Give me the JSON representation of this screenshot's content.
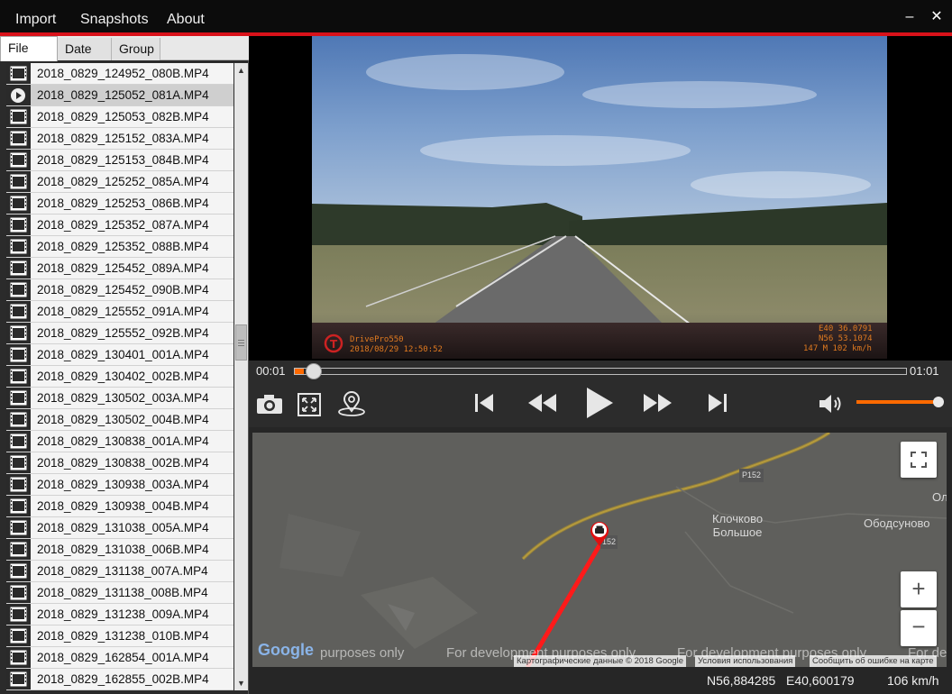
{
  "menu": {
    "import": "Import",
    "snapshots": "Snapshots",
    "about": "About"
  },
  "window": {
    "minimize": "–",
    "close": "✕"
  },
  "tabs": [
    {
      "label": "File"
    },
    {
      "label": "Date"
    },
    {
      "label": "Group"
    }
  ],
  "files": [
    "2018_0829_124952_080B.MP4",
    "2018_0829_125052_081A.MP4",
    "2018_0829_125053_082B.MP4",
    "2018_0829_125152_083A.MP4",
    "2018_0829_125153_084B.MP4",
    "2018_0829_125252_085A.MP4",
    "2018_0829_125253_086B.MP4",
    "2018_0829_125352_087A.MP4",
    "2018_0829_125352_088B.MP4",
    "2018_0829_125452_089A.MP4",
    "2018_0829_125452_090B.MP4",
    "2018_0829_125552_091A.MP4",
    "2018_0829_125552_092B.MP4",
    "2018_0829_130401_001A.MP4",
    "2018_0829_130402_002B.MP4",
    "2018_0829_130502_003A.MP4",
    "2018_0829_130502_004B.MP4",
    "2018_0829_130838_001A.MP4",
    "2018_0829_130838_002B.MP4",
    "2018_0829_130938_003A.MP4",
    "2018_0829_130938_004B.MP4",
    "2018_0829_131038_005A.MP4",
    "2018_0829_131038_006B.MP4",
    "2018_0829_131138_007A.MP4",
    "2018_0829_131138_008B.MP4",
    "2018_0829_131238_009A.MP4",
    "2018_0829_131238_010B.MP4",
    "2018_0829_162854_001A.MP4",
    "2018_0829_162855_002B.MP4"
  ],
  "selected_file_index": 1,
  "video_osd": {
    "brand": "DrivePro550",
    "datetime": "2018/08/29 12:50:52",
    "lon": "E40 36.0791",
    "lat": "N56 53.1074",
    "alt_speed": "147 M  102 km/h"
  },
  "playback": {
    "current_time": "00:01",
    "total_time": "01:01",
    "progress": 0.015,
    "volume": 0.95
  },
  "controls": {
    "snapshot_icon": "camera-icon",
    "fullscreen_icon": "fullscreen-icon",
    "map_icon": "map-pin-icon",
    "prev_icon": "skip-previous-icon",
    "rewind_icon": "rewind-icon",
    "play_icon": "play-icon",
    "forward_icon": "fast-forward-icon",
    "next_icon": "skip-next-icon",
    "volume_icon": "volume-icon"
  },
  "map": {
    "places": [
      "Клочково\nБольшое",
      "Ободсуново",
      "Ол"
    ],
    "road_label": "P152",
    "road_label_2": "152",
    "watermarks": [
      "purposes only",
      "For development purposes only",
      "For development purposes only",
      "For de"
    ],
    "google_logo": "Google",
    "attribution": [
      "Картографические данные © 2018 Google",
      "Условия использования",
      "Сообщить об ошибке на карте"
    ],
    "zoom_in": "+",
    "zoom_out": "−"
  },
  "status": {
    "lat": "N56,884285",
    "lon": "E40,600179",
    "speed": "106 km/h"
  },
  "colors": {
    "accent": "#ff6a00",
    "brand_red": "#d9121a",
    "route": "#ff0000"
  }
}
